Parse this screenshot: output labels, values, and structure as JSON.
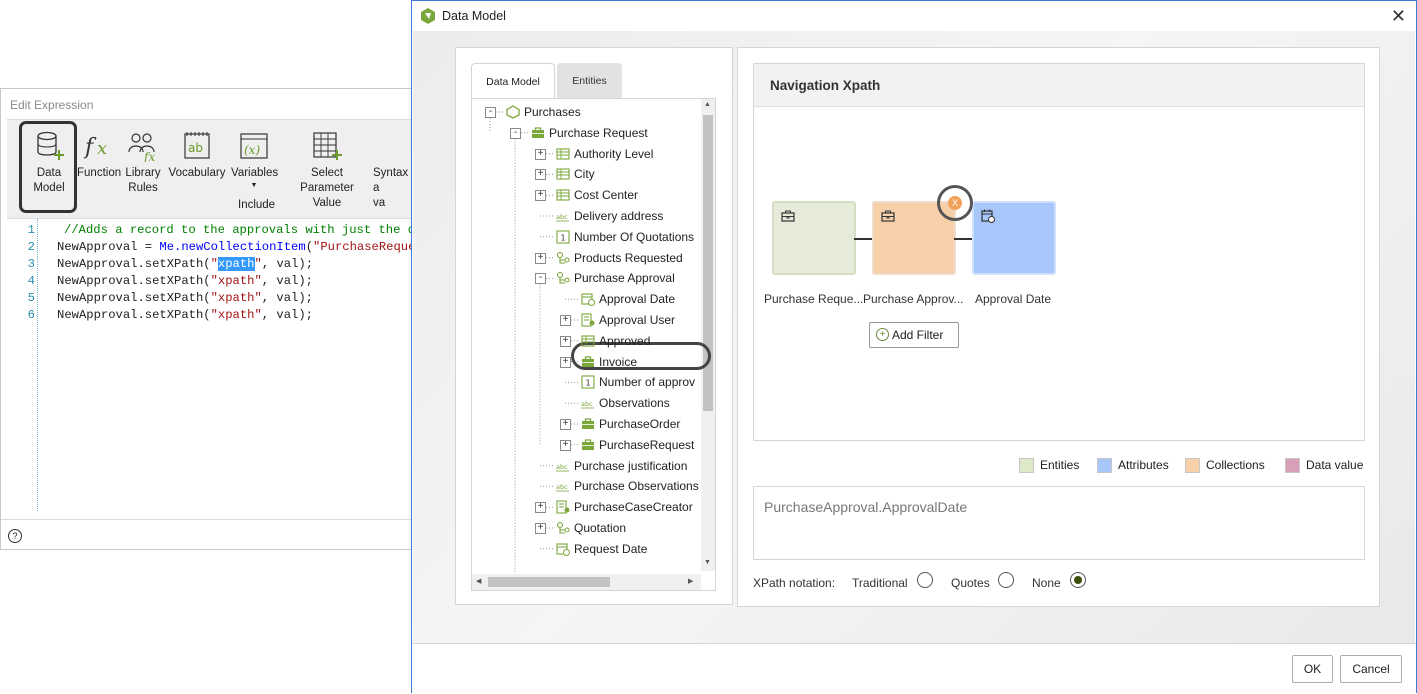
{
  "edit_window": {
    "title": "Edit Expression",
    "toolbar": [
      {
        "label": "Data\nModel",
        "icon": "database-add-icon"
      },
      {
        "label": "Function",
        "icon": "fx-icon"
      },
      {
        "label": "Library\nRules",
        "icon": "library-rules-icon"
      },
      {
        "label": "Vocabulary",
        "icon": "vocabulary-icon"
      },
      {
        "label": "Variables",
        "icon": "variables-icon"
      },
      {
        "label": "Select Parameter\nValue",
        "icon": "select-parameter-icon"
      },
      {
        "label": "Syntax a\nva",
        "icon": "syntax-icon"
      }
    ],
    "include_label": "Include",
    "code_lines": [
      {
        "n": "1",
        "parts": [
          {
            "t": "//Adds a record to the approvals with just the date",
            "c": "c-comment"
          }
        ]
      },
      {
        "n": "2",
        "parts": [
          {
            "t": "NewApproval = ",
            "c": ""
          },
          {
            "t": "Me.newCollectionItem",
            "c": "c-me"
          },
          {
            "t": "(",
            "c": ""
          },
          {
            "t": "\"PurchaseRequest",
            "c": "c-str"
          }
        ]
      },
      {
        "n": "3",
        "parts": [
          {
            "t": "NewApproval.setXPath(",
            "c": ""
          },
          {
            "t": "\"",
            "c": "c-str"
          },
          {
            "t": "xpath",
            "c": "c-sel"
          },
          {
            "t": "\"",
            "c": "c-str"
          },
          {
            "t": ", val);",
            "c": ""
          }
        ]
      },
      {
        "n": "4",
        "parts": [
          {
            "t": "NewApproval.setXPath(",
            "c": ""
          },
          {
            "t": "\"xpath\"",
            "c": "c-str"
          },
          {
            "t": ", val);",
            "c": ""
          }
        ]
      },
      {
        "n": "5",
        "parts": [
          {
            "t": "NewApproval.setXPath(",
            "c": ""
          },
          {
            "t": "\"xpath\"",
            "c": "c-str"
          },
          {
            "t": ", val);",
            "c": ""
          }
        ]
      },
      {
        "n": "6",
        "parts": [
          {
            "t": "NewApproval.setXPath(",
            "c": ""
          },
          {
            "t": "\"xpath\"",
            "c": "c-str"
          },
          {
            "t": ", val);",
            "c": ""
          }
        ]
      }
    ],
    "help_icon": "?"
  },
  "dialog": {
    "title": "Data Model",
    "close": "✕",
    "tabs": {
      "data_model": "Data Model",
      "entities": "Entities"
    },
    "tree": [
      {
        "label": "Purchases",
        "level": 0,
        "exp": "-",
        "icon": "entity-root-icon"
      },
      {
        "label": "Purchase Request",
        "level": 1,
        "exp": "-",
        "icon": "briefcase-icon"
      },
      {
        "label": "Authority Level",
        "level": 2,
        "exp": "+",
        "icon": "table-icon"
      },
      {
        "label": "City",
        "level": 2,
        "exp": "+",
        "icon": "table-icon"
      },
      {
        "label": "Cost Center",
        "level": 2,
        "exp": "+",
        "icon": "table-icon"
      },
      {
        "label": "Delivery address",
        "level": 2,
        "exp": "",
        "icon": "text-attr-icon"
      },
      {
        "label": "Number Of Quotations",
        "level": 2,
        "exp": "",
        "icon": "number-attr-icon"
      },
      {
        "label": "Products Requested",
        "level": 2,
        "exp": "+",
        "icon": "collection-icon"
      },
      {
        "label": "Purchase Approval",
        "level": 2,
        "exp": "-",
        "icon": "collection-icon"
      },
      {
        "label": "Approval Date",
        "level": 3,
        "exp": "",
        "icon": "date-attr-icon"
      },
      {
        "label": "Approval User",
        "level": 3,
        "exp": "+",
        "icon": "user-attr-icon"
      },
      {
        "label": "Approved",
        "level": 3,
        "exp": "+",
        "icon": "table-icon"
      },
      {
        "label": "Invoice",
        "level": 3,
        "exp": "+",
        "icon": "briefcase-icon"
      },
      {
        "label": "Number of approv",
        "level": 3,
        "exp": "",
        "icon": "number-attr-icon"
      },
      {
        "label": "Observations",
        "level": 3,
        "exp": "",
        "icon": "text-attr-icon"
      },
      {
        "label": "PurchaseOrder",
        "level": 3,
        "exp": "+",
        "icon": "briefcase-icon"
      },
      {
        "label": "PurchaseRequest",
        "level": 3,
        "exp": "+",
        "icon": "briefcase-icon"
      },
      {
        "label": "Purchase justification",
        "level": 2,
        "exp": "",
        "icon": "text-attr-icon"
      },
      {
        "label": "Purchase Observations",
        "level": 2,
        "exp": "",
        "icon": "text-attr-icon"
      },
      {
        "label": "PurchaseCaseCreator",
        "level": 2,
        "exp": "+",
        "icon": "user-attr-icon"
      },
      {
        "label": "Quotation",
        "level": 2,
        "exp": "+",
        "icon": "collection-icon"
      },
      {
        "label": "Request Date",
        "level": 2,
        "exp": "",
        "icon": "date-attr-icon"
      }
    ],
    "navigation": {
      "title": "Navigation Xpath",
      "nodes": [
        {
          "label": "Purchase Reque...",
          "kind": "entity"
        },
        {
          "label": "Purchase Approv...",
          "kind": "collection"
        },
        {
          "label": "Approval Date",
          "kind": "attribute"
        }
      ],
      "remove_glyph": "X",
      "add_filter": "Add Filter"
    },
    "legend": [
      {
        "label": "Entities",
        "color": "#dde8c8"
      },
      {
        "label": "Attributes",
        "color": "#a7c7fb"
      },
      {
        "label": "Collections",
        "color": "#f7cfa9"
      },
      {
        "label": "Data value",
        "color": "#d8a0b8"
      }
    ],
    "xpath_value": "PurchaseApproval.ApprovalDate",
    "notation": {
      "label": "XPath notation:",
      "options": [
        {
          "label": "Traditional",
          "selected": false
        },
        {
          "label": "Quotes",
          "selected": false
        },
        {
          "label": "None",
          "selected": true
        }
      ]
    },
    "ok": "OK",
    "cancel": "Cancel"
  }
}
